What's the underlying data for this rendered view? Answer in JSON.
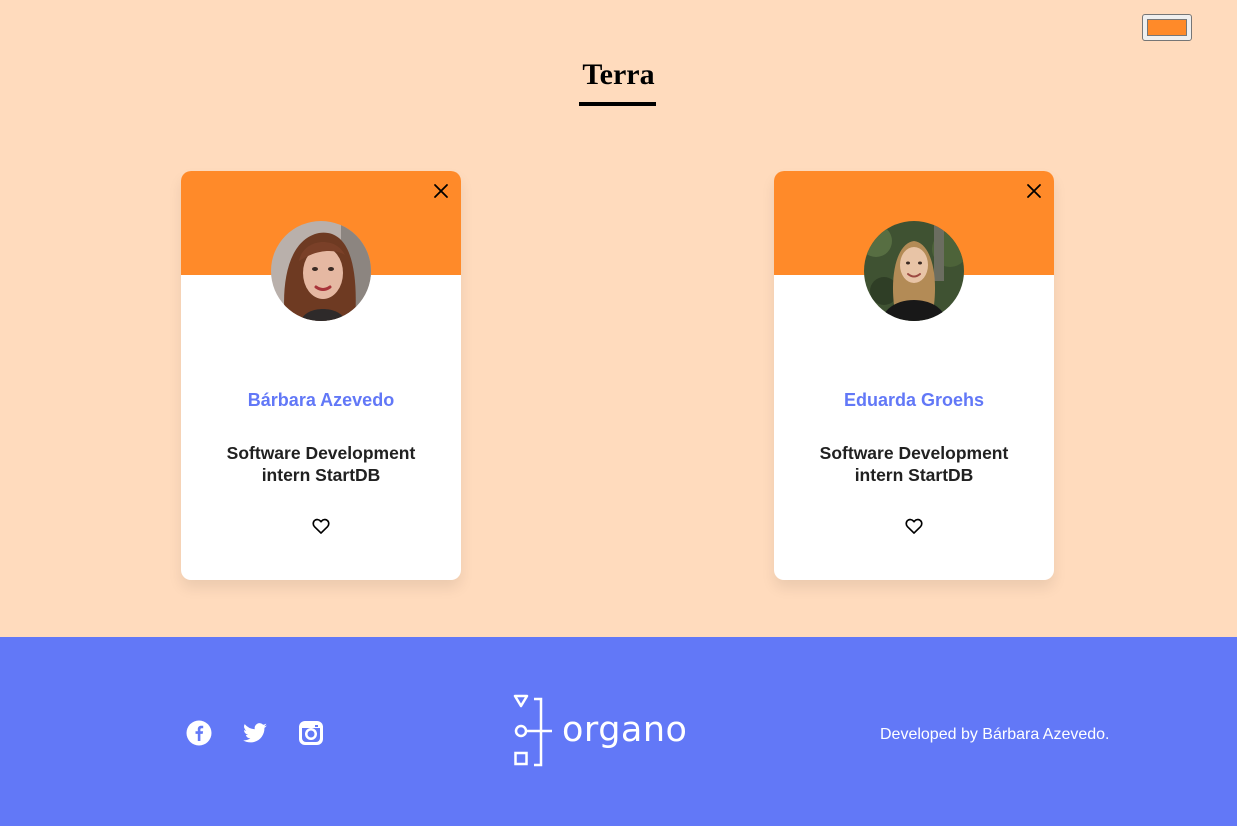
{
  "team": {
    "title": "Terra",
    "primary_color": "#FF8A29",
    "secondary_color": "#FFDBBD",
    "color_picker_value": "#FF8A29"
  },
  "members": [
    {
      "name": "Bárbara Azevedo",
      "role": "Software Development intern StartDB",
      "close_icon": "close-icon",
      "favorite_icon": "heart-outline-icon"
    },
    {
      "name": "Eduarda Groehs",
      "role": "Software Development intern StartDB",
      "close_icon": "close-icon",
      "favorite_icon": "heart-outline-icon"
    }
  ],
  "footer": {
    "background_color": "#6278F7",
    "social": [
      "facebook-icon",
      "twitter-icon",
      "instagram-icon"
    ],
    "logo_text": "organo",
    "credits": "Developed by Bárbara Azevedo."
  }
}
